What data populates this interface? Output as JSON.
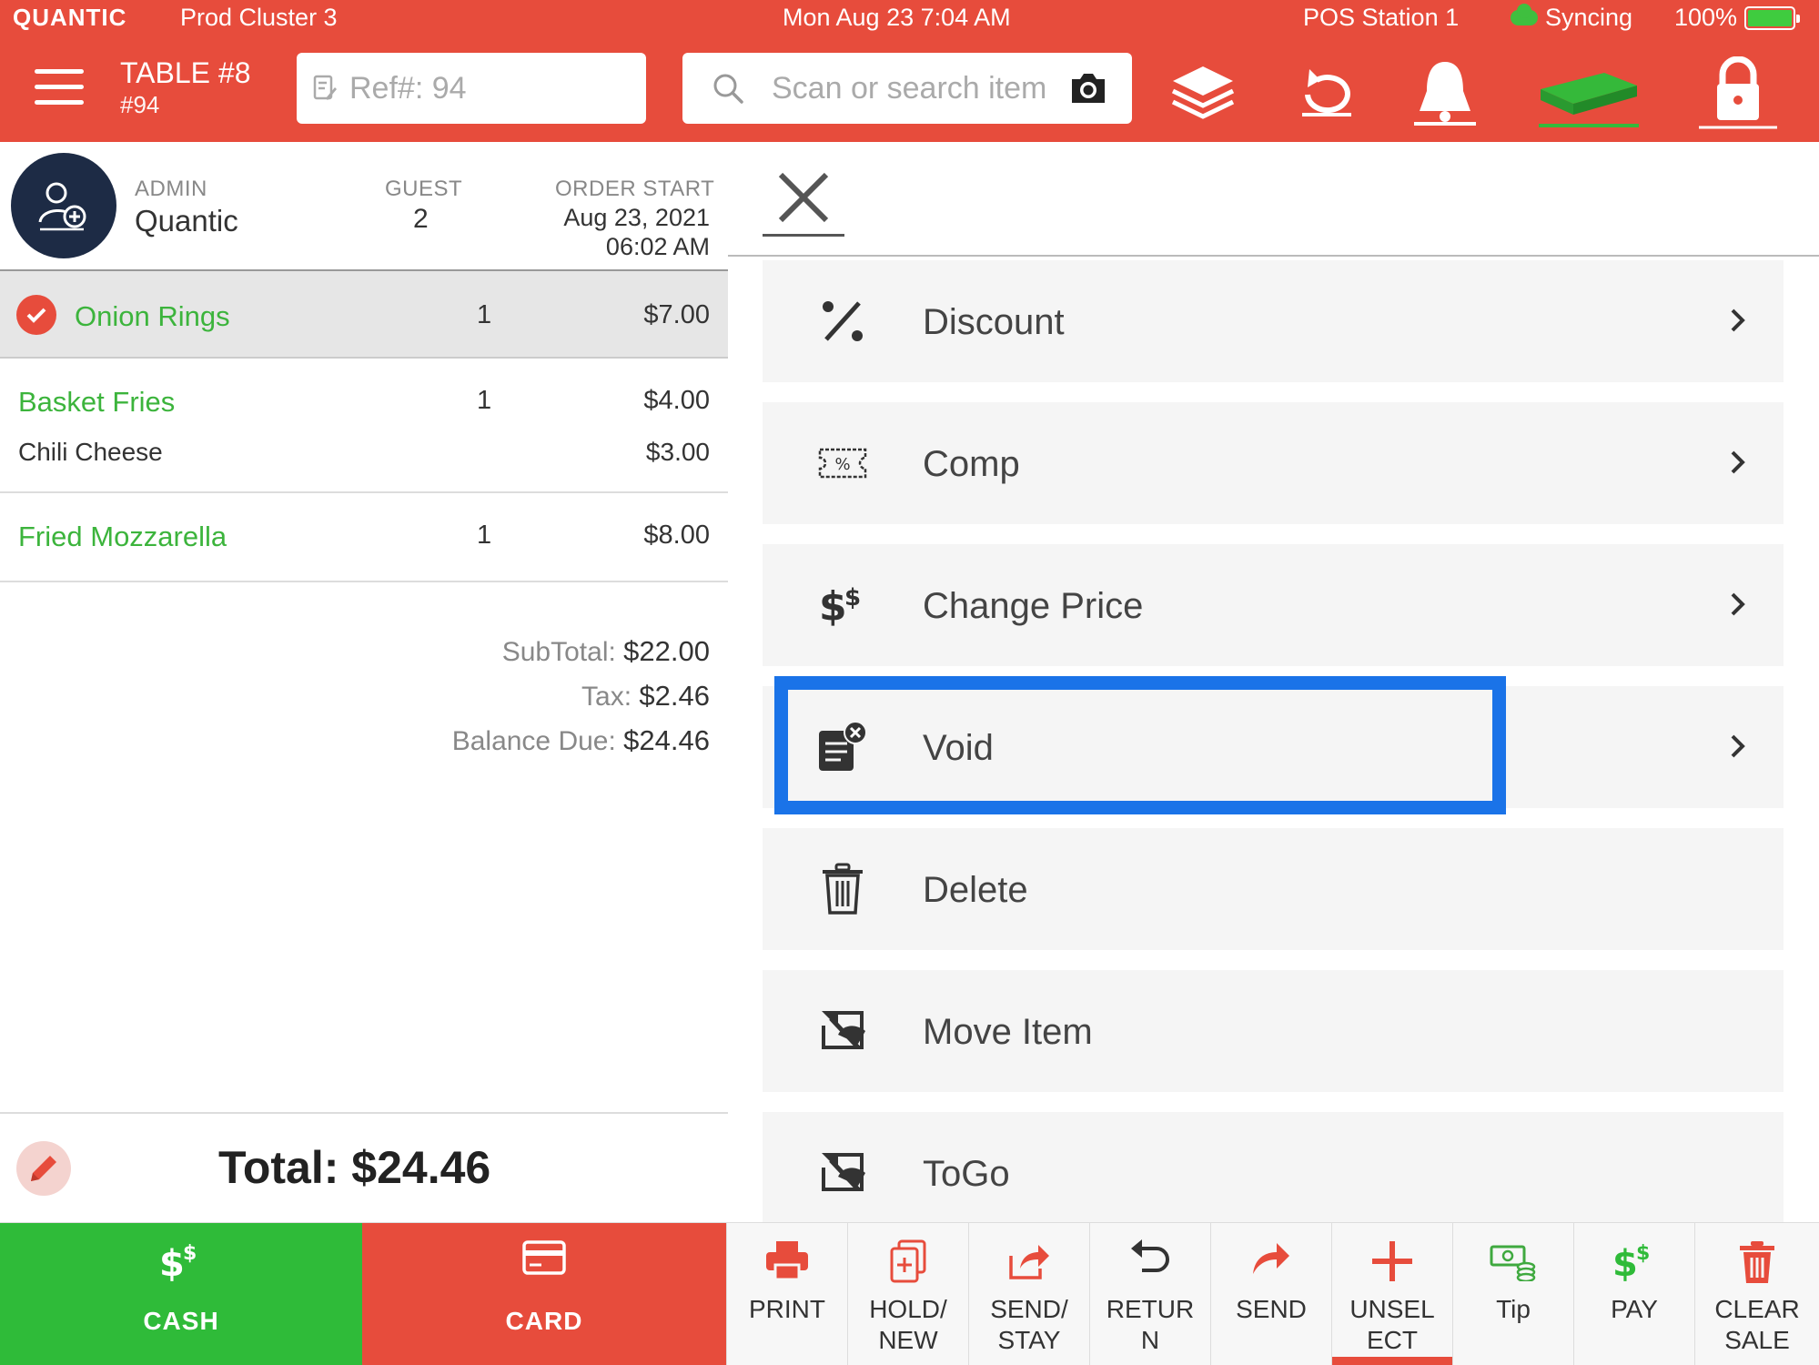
{
  "status_bar": {
    "brand": "QUANTIC",
    "cluster": "Prod Cluster 3",
    "datetime": "Mon Aug 23 7:04 AM",
    "station": "POS Station 1",
    "sync": "Syncing",
    "battery": "100%"
  },
  "header": {
    "table_title": "TABLE #8",
    "table_sub": "#94",
    "ref_placeholder": "Ref#: 94",
    "search_placeholder": "Scan or search item"
  },
  "order_header": {
    "admin_label": "ADMIN",
    "admin_name": "Quantic",
    "guest_label": "GUEST",
    "guest_count": "2",
    "order_start_label": "ORDER START",
    "order_date": "Aug 23, 2021",
    "order_time": "06:02 AM"
  },
  "items": [
    {
      "name": "Onion Rings",
      "qty": "1",
      "price": "$7.00"
    },
    {
      "name": "Basket Fries",
      "qty": "1",
      "price": "$4.00",
      "modifier": "Chili Cheese",
      "modifier_price": "$3.00"
    },
    {
      "name": "Fried Mozzarella",
      "qty": "1",
      "price": "$8.00"
    }
  ],
  "summary": {
    "subtotal_label": "SubTotal:",
    "subtotal": "$22.00",
    "tax_label": "Tax:",
    "tax": "$2.46",
    "balance_label": "Balance Due:",
    "balance": "$24.46",
    "total": "Total: $24.46"
  },
  "options": [
    {
      "label": "Discount",
      "icon": "percent-icon"
    },
    {
      "label": "Comp",
      "icon": "coupon-icon"
    },
    {
      "label": "Change Price",
      "icon": "price-change-icon"
    },
    {
      "label": "Void",
      "icon": "void-icon"
    },
    {
      "label": "Delete",
      "icon": "trash-icon"
    },
    {
      "label": "Move Item",
      "icon": "move-icon"
    },
    {
      "label": "ToGo",
      "icon": "togo-icon"
    }
  ],
  "bottom": {
    "cash": "CASH",
    "card": "CARD",
    "print": "PRINT",
    "hold_l1": "HOLD/",
    "hold_l2": "NEW",
    "sendstay_l1": "SEND/",
    "sendstay_l2": "STAY",
    "return_l1": "RETUR",
    "return_l2": "N",
    "send": "SEND",
    "unselect_l1": "UNSEL",
    "unselect_l2": "ECT",
    "tip": "Tip",
    "pay": "PAY",
    "clear_l1": "CLEAR",
    "clear_l2": "SALE"
  },
  "colors": {
    "brand_red": "#e74c3c",
    "green": "#2fbb39",
    "highlight_blue": "#1a73e8",
    "avatar_navy": "#1d2b45"
  }
}
